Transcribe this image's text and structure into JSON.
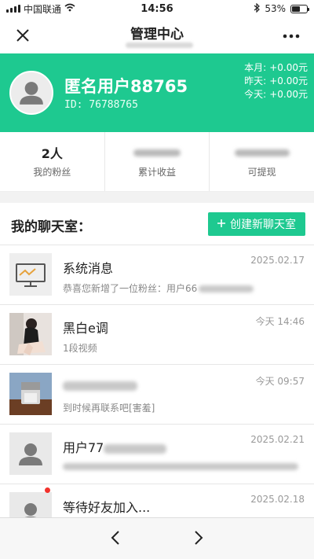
{
  "status": {
    "carrier": "中国联通",
    "time": "14:56",
    "battery": "53%",
    "battery_level": 0.53
  },
  "nav": {
    "title": "管理中心"
  },
  "profile": {
    "name": "匿名用户88765",
    "uid": "ID: 76788765",
    "earnings": [
      {
        "label": "本月:",
        "value": "+0.00元"
      },
      {
        "label": "昨天:",
        "value": "+0.00元"
      },
      {
        "label": "今天:",
        "value": "+0.00元"
      }
    ]
  },
  "stats": {
    "fans": {
      "value": "2人",
      "label": "我的粉丝"
    },
    "income": {
      "label": "累计收益"
    },
    "withdraw": {
      "label": "可提现"
    }
  },
  "chat": {
    "header": "我的聊天室：",
    "create_button": "创建新聊天室",
    "items": [
      {
        "name": "系统消息",
        "preview": "恭喜您新增了一位粉丝：用户66",
        "time": "2025.02.17"
      },
      {
        "name": "黑白e调",
        "preview": "1段视频",
        "time": "今天 14:46"
      },
      {
        "name": "",
        "preview": "到时候再联系吧[害羞]",
        "time": "今天 09:57"
      },
      {
        "name": "用户77",
        "preview": "",
        "time": "2025.02.21"
      },
      {
        "name": "等待好友加入...",
        "preview": "",
        "time": "2025.02.18"
      }
    ]
  },
  "colors": {
    "accent": "#1ec990",
    "unread_dot": "#f2322c"
  },
  "icons": {
    "close": "close-icon",
    "more": "more-icon",
    "prev": "chevron-left-icon",
    "next": "chevron-right-icon",
    "plus": "plus-icon"
  }
}
